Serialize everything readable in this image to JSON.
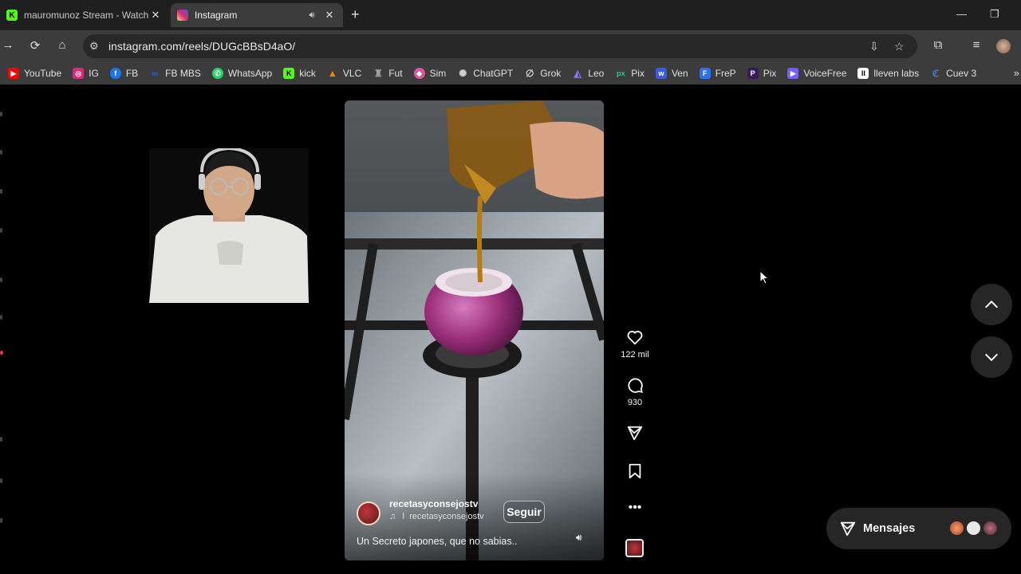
{
  "browser": {
    "tabs": [
      {
        "title": "mauromunoz Stream - Watch Live on Kick",
        "favicon": "kick-icon",
        "active": false
      },
      {
        "title": "Instagram",
        "favicon": "instagram-icon",
        "active": true
      }
    ],
    "url": "instagram.com/reels/DUGcBBsD4aO/",
    "bookmarks": [
      {
        "label": "YouTube",
        "icon": "youtube-icon",
        "color": "#ff0000"
      },
      {
        "label": "IG",
        "icon": "instagram-icon",
        "color": "#d62976"
      },
      {
        "label": "FB",
        "icon": "facebook-icon",
        "color": "#1877f2"
      },
      {
        "label": "FB MBS",
        "icon": "meta-icon",
        "color": "#0866ff"
      },
      {
        "label": "WhatsApp",
        "icon": "whatsapp-icon",
        "color": "#25d366"
      },
      {
        "label": "kick",
        "icon": "kick-icon",
        "color": "#53fc18"
      },
      {
        "label": "VLC",
        "icon": "vlc-icon",
        "color": "#f48b00"
      },
      {
        "label": "Fut",
        "icon": "fut-icon",
        "color": "#9aa0a6"
      },
      {
        "label": "Sim",
        "icon": "sim-icon",
        "color": "#e0559d"
      },
      {
        "label": "ChatGPT",
        "icon": "chatgpt-icon",
        "color": "#d0d0d0"
      },
      {
        "label": "Grok",
        "icon": "grok-icon",
        "color": "#d0d0d0"
      },
      {
        "label": "Leo",
        "icon": "leo-icon",
        "color": "#8a7cff"
      },
      {
        "label": "Pix",
        "icon": "pix-icon",
        "color": "#31c48d"
      },
      {
        "label": "Ven",
        "icon": "ven-icon",
        "color": "#3b5bdb"
      },
      {
        "label": "FreP",
        "icon": "frep-icon",
        "color": "#2f6fed"
      },
      {
        "label": "Pix",
        "icon": "pix-dark-icon",
        "color": "#3a1c5c"
      },
      {
        "label": "VoiceFree",
        "icon": "voicefree-icon",
        "color": "#7b5cff"
      },
      {
        "label": "lleven labs",
        "icon": "elevenlabs-icon",
        "color": "#ffffff"
      },
      {
        "label": "Cuev 3",
        "icon": "cuev-icon",
        "color": "#3d7bd9"
      }
    ]
  },
  "reel": {
    "author": "recetasyconsejostv",
    "audio": "recetasyconsejostv",
    "follow_label": "Seguir",
    "caption": "Un Secreto japones, que no sabias..",
    "likes": "122 mil",
    "comments": "930"
  },
  "messages": {
    "label": "Mensajes"
  },
  "colors": {
    "background": "#000000",
    "panel": "#262626",
    "onion": "#9b2f7a",
    "steel": "#8e969c"
  }
}
